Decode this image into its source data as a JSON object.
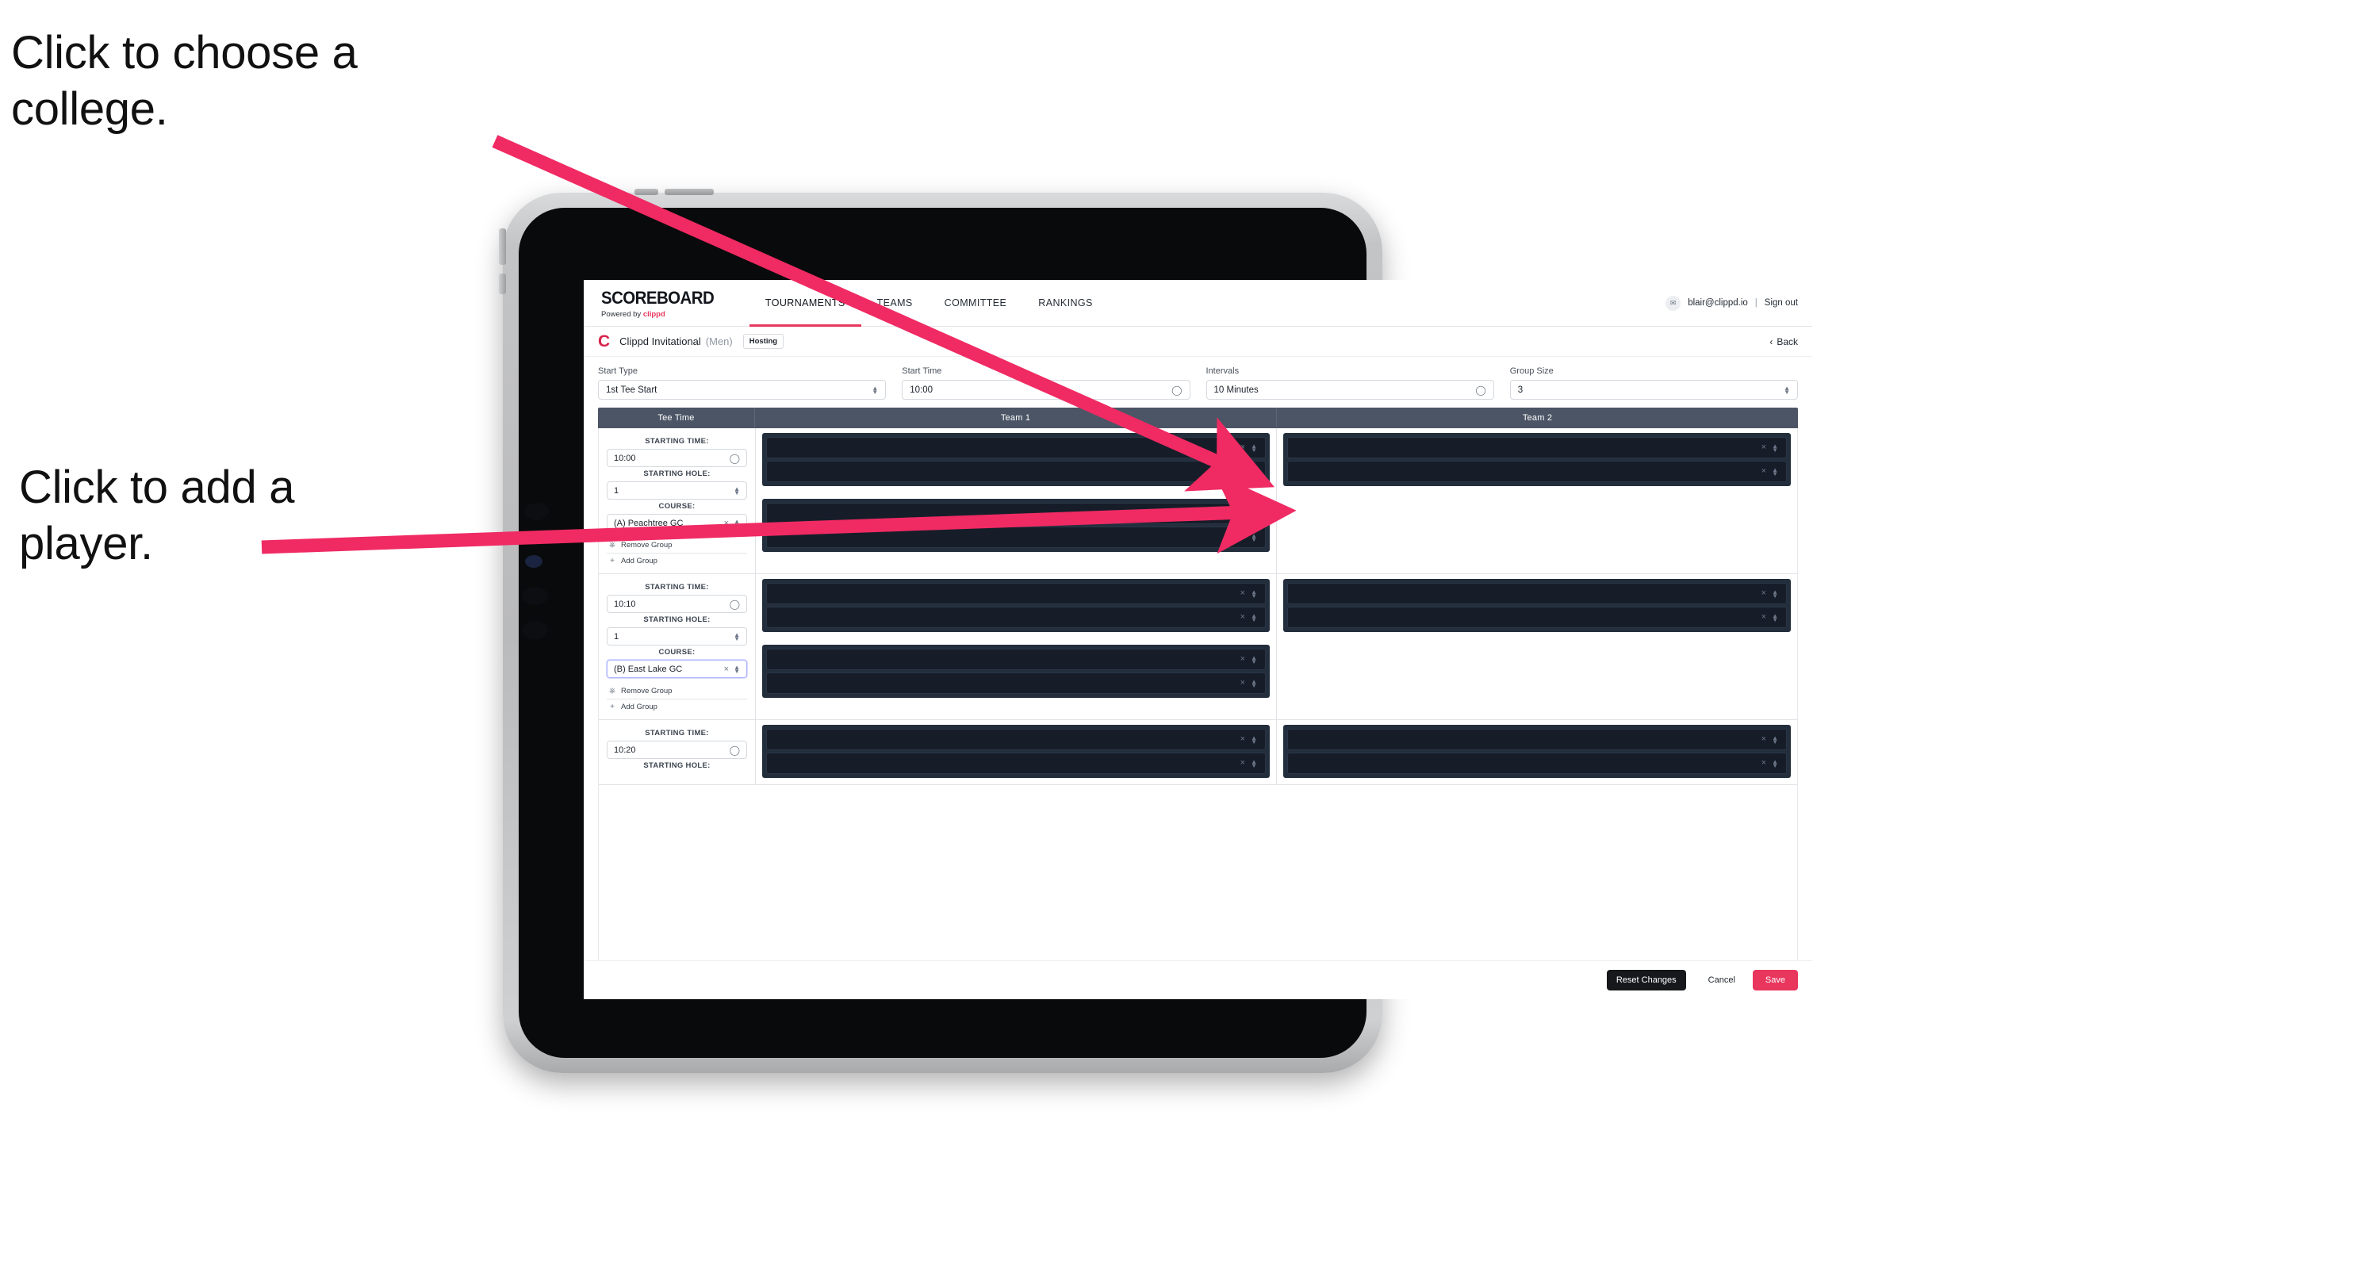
{
  "annotations": [
    {
      "id": "choose-college",
      "text": "Click to choose a college."
    },
    {
      "id": "add-player",
      "text": "Click to add a player."
    }
  ],
  "colors": {
    "accent": "#e8365d",
    "header_row": "#4b5565",
    "player_group": "#232e3d",
    "player_slot": "#161d29",
    "dark_button": "#16181c"
  },
  "topnav": {
    "brand_word": "SCOREBOARD",
    "brand_sub_prefix": "Powered by ",
    "brand_sub_mark": "clippd",
    "tabs": [
      {
        "label": "TOURNAMENTS",
        "active": true
      },
      {
        "label": "TEAMS",
        "active": false
      },
      {
        "label": "COMMITTEE",
        "active": false
      },
      {
        "label": "RANKINGS",
        "active": false
      }
    ],
    "avatar_glyph": "✉",
    "user_email": "blair@clippd.io",
    "separator": "|",
    "sign_out": "Sign out"
  },
  "tournament_bar": {
    "logo_letter": "C",
    "name": "Clippd Invitational",
    "gender": "(Men)",
    "badge": "Hosting",
    "back_chevron": "‹",
    "back_label": "Back"
  },
  "settings": [
    {
      "name": "start-type",
      "label": "Start Type",
      "value": "1st Tee Start",
      "icon": "spinner"
    },
    {
      "name": "start-time",
      "label": "Start Time",
      "value": "10:00",
      "icon": "clock"
    },
    {
      "name": "intervals",
      "label": "Intervals",
      "value": "10 Minutes",
      "icon": "clock"
    },
    {
      "name": "group-size",
      "label": "Group Size",
      "value": "3",
      "icon": "spinner"
    }
  ],
  "table": {
    "headers": [
      "Tee Time",
      "Team 1",
      "Team 2"
    ],
    "labels": {
      "starting_time": "STARTING TIME:",
      "starting_hole": "STARTING HOLE:",
      "course": "COURSE:"
    },
    "group_actions": {
      "remove": "Remove Group",
      "remove_icon": "Ὕ1",
      "add": "Add Group",
      "add_icon": "+"
    },
    "clear_icon": "×",
    "rows": [
      {
        "starting_time": "10:00",
        "starting_hole": "1",
        "course": "(A) Peachtree GC",
        "course_focused": false,
        "team1_groups": [
          {
            "slots": [
              "",
              ""
            ]
          },
          {
            "slots": [
              "",
              ""
            ]
          }
        ],
        "team2_groups": [
          {
            "slots": [
              "",
              ""
            ]
          }
        ]
      },
      {
        "starting_time": "10:10",
        "starting_hole": "1",
        "course": "(B) East Lake GC",
        "course_focused": true,
        "team1_groups": [
          {
            "slots": [
              "",
              ""
            ]
          },
          {
            "slots": [
              "",
              ""
            ]
          }
        ],
        "team2_groups": [
          {
            "slots": [
              "",
              ""
            ]
          }
        ]
      },
      {
        "starting_time": "10:20",
        "starting_hole": "",
        "course": "",
        "course_focused": false,
        "partial": true,
        "team1_groups": [
          {
            "slots": [
              "",
              ""
            ]
          }
        ],
        "team2_groups": [
          {
            "slots": [
              "",
              ""
            ]
          }
        ]
      }
    ]
  },
  "footer": {
    "reset_label": "Reset Changes",
    "cancel_label": "Cancel",
    "save_label": "Save"
  }
}
